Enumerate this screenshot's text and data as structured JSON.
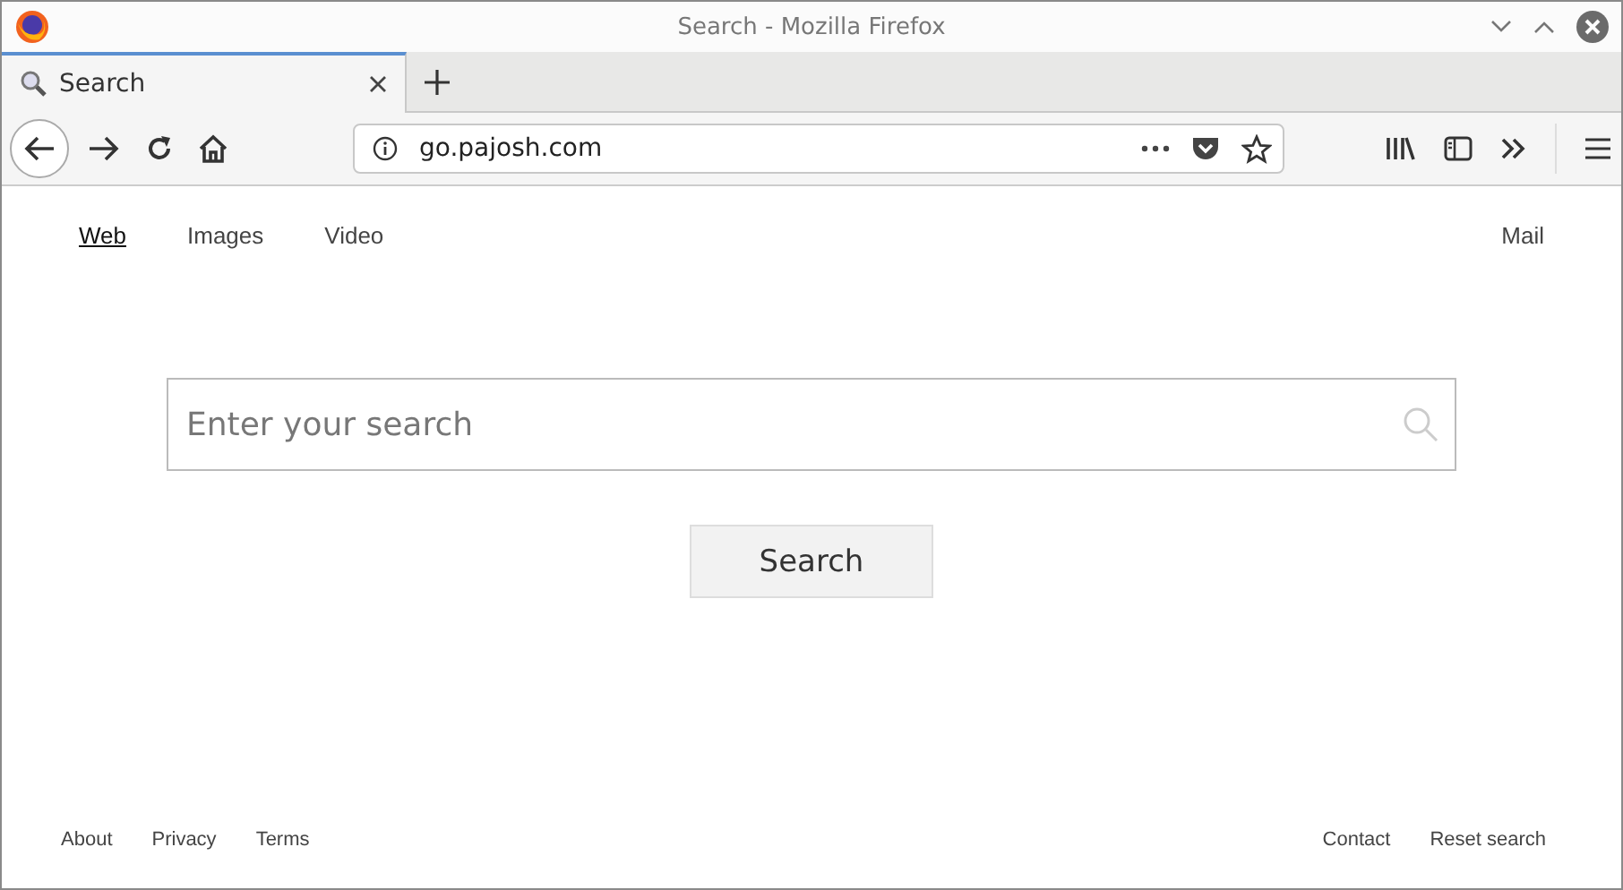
{
  "window": {
    "title": "Search - Mozilla Firefox"
  },
  "tabs": [
    {
      "label": "Search",
      "selected": true
    }
  ],
  "address_bar": {
    "url": "go.pajosh.com"
  },
  "nav_links": [
    {
      "label": "Web",
      "selected": true
    },
    {
      "label": "Images",
      "selected": false
    },
    {
      "label": "Video",
      "selected": false
    }
  ],
  "nav_right": [
    "Mail"
  ],
  "search": {
    "placeholder": "Enter your search",
    "button": "Search"
  },
  "footer_left": [
    "About",
    "Privacy",
    "Terms"
  ],
  "footer_right": [
    "Contact",
    "Reset search"
  ]
}
